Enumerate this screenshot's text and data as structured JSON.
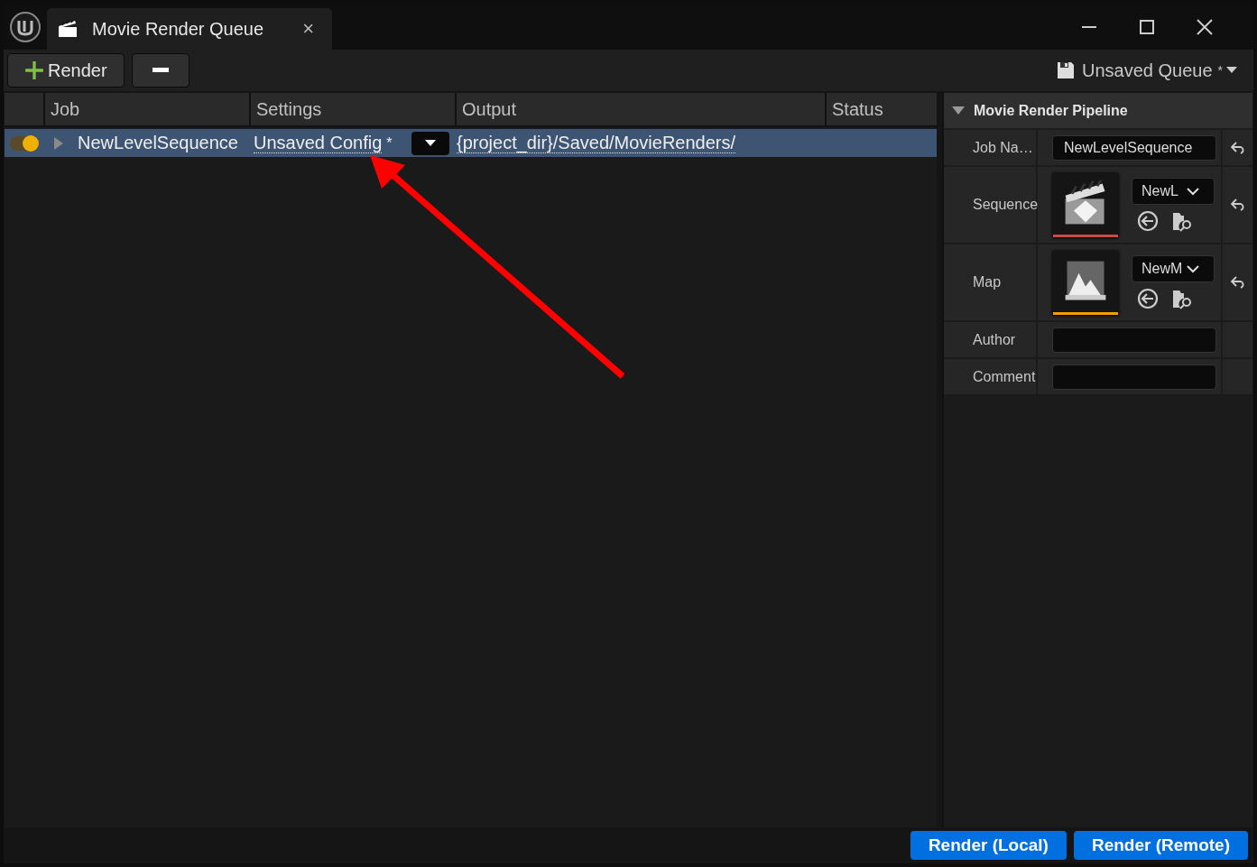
{
  "tab": {
    "title": "Movie Render Queue",
    "close": "×"
  },
  "toolbar": {
    "render_button": "Render",
    "queue_menu": {
      "label": "Unsaved Queue",
      "dirty": "*"
    }
  },
  "table": {
    "columns": [
      "Job",
      "Settings",
      "Output",
      "Status"
    ],
    "rows": [
      {
        "enabled": true,
        "expanded": false,
        "selected": true,
        "job": "NewLevelSequence",
        "settings": "Unsaved Config",
        "settings_dirty": "*",
        "output": "{project_dir}/Saved/MovieRenders/"
      }
    ]
  },
  "details": {
    "title": "Movie Render Pipeline",
    "expanded": true,
    "properties": [
      {
        "kind": "text",
        "label": "Job Na…",
        "value": "NewLevelSequence",
        "resettable": true
      },
      {
        "kind": "sequence",
        "label": "Sequence",
        "value": "NewL",
        "color": "#c84a4a",
        "resettable": true
      },
      {
        "kind": "map",
        "label": "Map",
        "value": "NewM",
        "color": "#f0a000",
        "resettable": true
      },
      {
        "kind": "text",
        "label": "Author",
        "resettable": false
      },
      {
        "kind": "text",
        "label": "Comment",
        "resettable": false
      }
    ]
  },
  "footer": {
    "buttons": [
      "Render (Local)",
      "Render (Remote)"
    ]
  }
}
